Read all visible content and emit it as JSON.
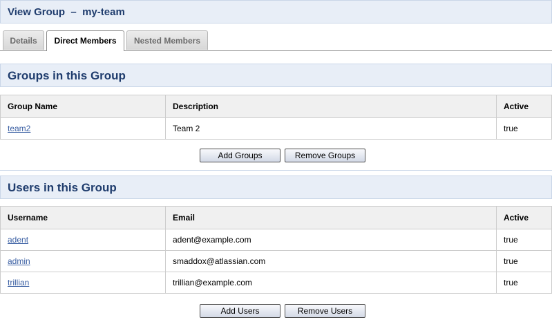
{
  "header": {
    "title": "View Group  –  my-team"
  },
  "tabs": [
    {
      "label": "Details",
      "active": false
    },
    {
      "label": "Direct Members",
      "active": true
    },
    {
      "label": "Nested Members",
      "active": false
    }
  ],
  "groups_section": {
    "title": "Groups in this Group",
    "columns": [
      "Group Name",
      "Description",
      "Active"
    ],
    "rows": [
      {
        "name": "team2",
        "description": "Team 2",
        "active": "true"
      }
    ],
    "add_button": "Add Groups",
    "remove_button": "Remove Groups"
  },
  "users_section": {
    "title": "Users in this Group",
    "columns": [
      "Username",
      "Email",
      "Active"
    ],
    "rows": [
      {
        "username": "adent",
        "email": "adent@example.com",
        "active": "true"
      },
      {
        "username": "admin",
        "email": "smaddox@atlassian.com",
        "active": "true"
      },
      {
        "username": "trillian",
        "email": "trillian@example.com",
        "active": "true"
      }
    ],
    "add_button": "Add Users",
    "remove_button": "Remove Users"
  },
  "colors": {
    "accent": "#1f3c6d",
    "header_bg": "#e8eef7",
    "link": "#3a5fa3"
  }
}
